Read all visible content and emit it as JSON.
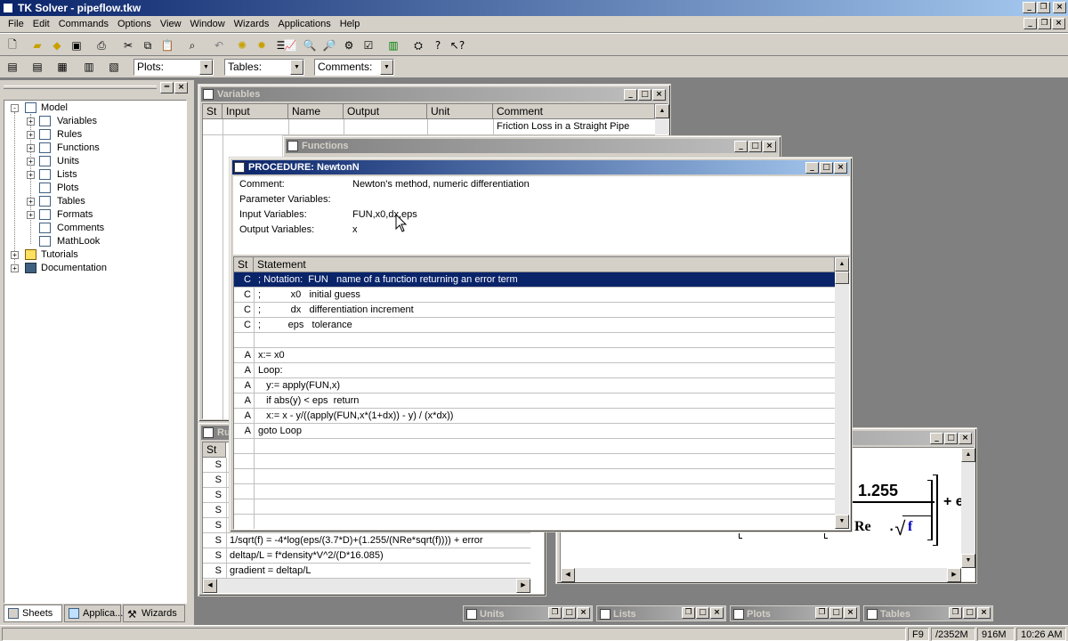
{
  "app": {
    "title": "TK Solver - pipeflow.tkw"
  },
  "menu": [
    "File",
    "Edit",
    "Commands",
    "Options",
    "View",
    "Window",
    "Wizards",
    "Applications",
    "Help"
  ],
  "toolbar2": {
    "plots": "Plots:",
    "tables": "Tables:",
    "comments": "Comments:"
  },
  "tree": {
    "items": [
      {
        "label": "Model",
        "level": 0,
        "expander": "-"
      },
      {
        "label": "Variables",
        "level": 1,
        "expander": "+"
      },
      {
        "label": "Rules",
        "level": 1,
        "expander": "+"
      },
      {
        "label": "Functions",
        "level": 1,
        "expander": "+"
      },
      {
        "label": "Units",
        "level": 1,
        "expander": "+"
      },
      {
        "label": "Lists",
        "level": 1,
        "expander": "+"
      },
      {
        "label": "Plots",
        "level": 1,
        "expander": ""
      },
      {
        "label": "Tables",
        "level": 1,
        "expander": "+"
      },
      {
        "label": "Formats",
        "level": 1,
        "expander": "+"
      },
      {
        "label": "Comments",
        "level": 1,
        "expander": ""
      },
      {
        "label": "MathLook",
        "level": 1,
        "expander": ""
      },
      {
        "label": "Tutorials",
        "level": 0,
        "expander": "+"
      },
      {
        "label": "Documentation",
        "level": 0,
        "expander": "+"
      }
    ]
  },
  "left_tabs": [
    "Sheets",
    "Applica...",
    "Wizards"
  ],
  "variables": {
    "title": "Variables",
    "columns": [
      "St",
      "Input",
      "Name",
      "Output",
      "Unit",
      "Comment"
    ],
    "first_comment": "Friction Loss in a Straight Pipe"
  },
  "functions": {
    "title": "Functions"
  },
  "rules": {
    "title": "Ru",
    "st_header": "St",
    "rows": [
      {
        "st": "S",
        "text": ""
      },
      {
        "st": "S",
        "text": ""
      },
      {
        "st": "S",
        "text": ""
      },
      {
        "st": "S",
        "text": ""
      },
      {
        "st": "S",
        "text": ""
      },
      {
        "st": "S",
        "text": "1/sqrt(f) = -4*log(eps/(3.7*D)+(1.255/(NRe*sqrt(f)))) + error"
      },
      {
        "st": "S",
        "text": "deltap/L = f*density*V^2/(D*16.085)"
      },
      {
        "st": "S",
        "text": "gradient = deltap/L"
      }
    ]
  },
  "procedure": {
    "title": "PROCEDURE: NewtonN",
    "fields": [
      {
        "label": "Comment:",
        "value": "Newton's method, numeric differentiation"
      },
      {
        "label": "Parameter Variables:",
        "value": ""
      },
      {
        "label": "Input Variables:",
        "value": "FUN,x0,dx,eps"
      },
      {
        "label": "Output Variables:",
        "value": "x"
      }
    ],
    "columns": [
      "St",
      "Statement"
    ],
    "rows": [
      {
        "st": "C",
        "stmt": "; Notation:  FUN   name of a function returning an error term"
      },
      {
        "st": "C",
        "stmt": ";           x0   initial guess"
      },
      {
        "st": "C",
        "stmt": ";           dx   differentiation increment"
      },
      {
        "st": "C",
        "stmt": ";          eps   tolerance"
      },
      {
        "st": "",
        "stmt": ""
      },
      {
        "st": "A",
        "stmt": "x:= x0"
      },
      {
        "st": "A",
        "stmt": "Loop:"
      },
      {
        "st": "A",
        "stmt": "   y:= apply(FUN,x)"
      },
      {
        "st": "A",
        "stmt": "   if abs(y) < eps  return"
      },
      {
        "st": "A",
        "stmt": "   x:= x - y/((apply(FUN,x*(1+dx)) - y) / (x*dx))"
      },
      {
        "st": "A",
        "stmt": "goto Loop"
      }
    ]
  },
  "mathlook": {
    "n1": "1.255",
    "re": "Re",
    "f": "f",
    "tail": "+ e"
  },
  "minimized": [
    "Units",
    "Lists",
    "Plots",
    "Tables"
  ],
  "status": {
    "key": "F9",
    "mem1": "/2352M",
    "mem2": "916M",
    "time": "10:26 AM"
  }
}
